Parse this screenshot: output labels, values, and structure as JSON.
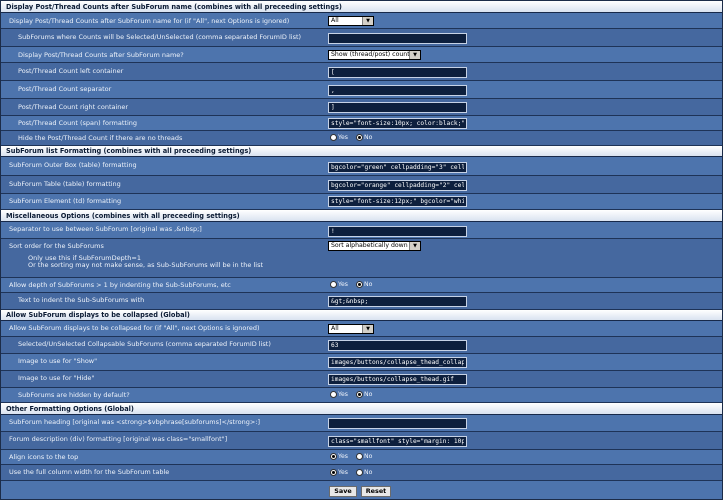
{
  "sections": {
    "s1": "Display Post/Thread Counts after SubForum name (combines with all preceeding settings)",
    "s2": "SubForum list Formatting (combines with all preceeding settings)",
    "s3": "Miscellaneous Options (combines with all preceeding settings)",
    "s4": "Allow SubForum displays to be collapsed (Global)",
    "s5": "Other Formatting Options (Global)"
  },
  "labels": {
    "r1": "Display Post/Thread Counts after SubForum name for (if \"All\", next Options is ignored)",
    "r2": "SubForums where Counts will be Selected/UnSelected (comma separated ForumID list)",
    "r3": "Display Post/Thread Counts after SubForum name?",
    "r4": "Post/Thread Count left container",
    "r5": "Post/Thread Count separator",
    "r6": "Post/Thread Count right container",
    "r7": "Post/Thread Count (span) formatting",
    "r8": "Hide the Post/Thread Count if there are no threads",
    "r9": "SubForum Outer Box (table) formatting",
    "r10": "SubForum Table (table) formatting",
    "r11": "SubForum Element (td) formatting",
    "r12": "Separator to use between SubForum [original was ,&nbsp;]",
    "r13": "Sort order for the SubForums",
    "r14a": "Only use this if SubForumDepth=1",
    "r14b": "Or the sorting may not make sense, as Sub-SubForums will be in the list",
    "r15": "Allow depth of SubForums > 1 by indenting the Sub-SubForums, etc",
    "r16": "Text to indent the Sub-SubForums with",
    "r17": "Allow SubForum displays to be collapsed for (if \"All\", next Options is ignored)",
    "r18": "Selected/UnSelected Collapsable SubForums (comma separated ForumID list)",
    "r19": "Image to use for \"Show\"",
    "r20": "Image to use for \"Hide\"",
    "r21": "SubForums are hidden by default?",
    "r22": "SubForum heading [original was <strong>$vbphrase[subforums]</strong>:]",
    "r23": "Forum description (div) formatting [original was class=\"smallfont\"]",
    "r24": "Align icons to the top",
    "r25": "Use the full column width for the SubForum table"
  },
  "values": {
    "r1": "All",
    "r2": "",
    "r3": "Show (thread/post) counts",
    "r4": "[",
    "r5": ",",
    "r6": "]",
    "r7": "style=\"font-size:10px; color:black;\"",
    "r9": "bgcolor=\"green\" cellpadding=\"3\" cellspacing=",
    "r10": "bgcolor=\"orange\" cellpadding=\"2\" cellspacing",
    "r11": "style=\"font-size:12px;\" bgcolor=\"white\"",
    "r12": "!",
    "r13": "Sort alphabetically down",
    "r16": "&gt;&nbsp;",
    "r17": "All",
    "r18": "63",
    "r19": "images/buttons/collapse_thead_collapsed.gif",
    "r20": "images/buttons/collapse_thead.gif",
    "r22": "",
    "r23": "class=\"smallfont\" style=\"margin: 10px 10px 0"
  },
  "radio": {
    "yes": "Yes",
    "no": "No"
  },
  "radio_state": {
    "r8": "No",
    "r15": "No",
    "r21": "No",
    "r24": "Yes",
    "r25": "Yes"
  },
  "buttons": {
    "save": "Save",
    "reset": "Reset"
  }
}
